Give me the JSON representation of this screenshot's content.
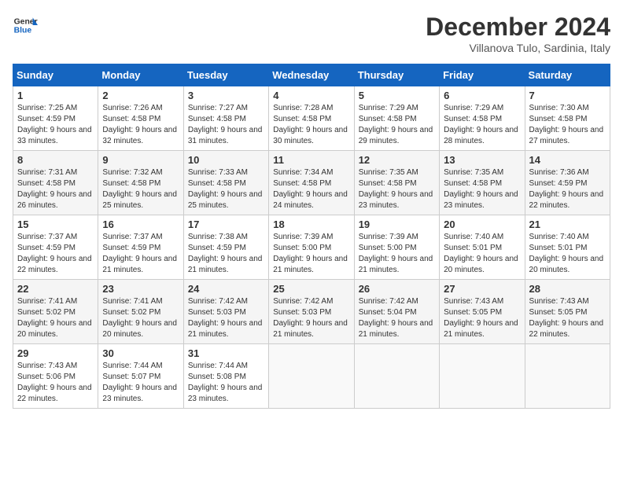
{
  "header": {
    "logo_line1": "General",
    "logo_line2": "Blue",
    "month": "December 2024",
    "location": "Villanova Tulo, Sardinia, Italy"
  },
  "days_of_week": [
    "Sunday",
    "Monday",
    "Tuesday",
    "Wednesday",
    "Thursday",
    "Friday",
    "Saturday"
  ],
  "weeks": [
    [
      {
        "day": "1",
        "sunrise": "7:25 AM",
        "sunset": "4:59 PM",
        "daylight": "9 hours and 33 minutes."
      },
      {
        "day": "2",
        "sunrise": "7:26 AM",
        "sunset": "4:58 PM",
        "daylight": "9 hours and 32 minutes."
      },
      {
        "day": "3",
        "sunrise": "7:27 AM",
        "sunset": "4:58 PM",
        "daylight": "9 hours and 31 minutes."
      },
      {
        "day": "4",
        "sunrise": "7:28 AM",
        "sunset": "4:58 PM",
        "daylight": "9 hours and 30 minutes."
      },
      {
        "day": "5",
        "sunrise": "7:29 AM",
        "sunset": "4:58 PM",
        "daylight": "9 hours and 29 minutes."
      },
      {
        "day": "6",
        "sunrise": "7:29 AM",
        "sunset": "4:58 PM",
        "daylight": "9 hours and 28 minutes."
      },
      {
        "day": "7",
        "sunrise": "7:30 AM",
        "sunset": "4:58 PM",
        "daylight": "9 hours and 27 minutes."
      }
    ],
    [
      {
        "day": "8",
        "sunrise": "7:31 AM",
        "sunset": "4:58 PM",
        "daylight": "9 hours and 26 minutes."
      },
      {
        "day": "9",
        "sunrise": "7:32 AM",
        "sunset": "4:58 PM",
        "daylight": "9 hours and 25 minutes."
      },
      {
        "day": "10",
        "sunrise": "7:33 AM",
        "sunset": "4:58 PM",
        "daylight": "9 hours and 25 minutes."
      },
      {
        "day": "11",
        "sunrise": "7:34 AM",
        "sunset": "4:58 PM",
        "daylight": "9 hours and 24 minutes."
      },
      {
        "day": "12",
        "sunrise": "7:35 AM",
        "sunset": "4:58 PM",
        "daylight": "9 hours and 23 minutes."
      },
      {
        "day": "13",
        "sunrise": "7:35 AM",
        "sunset": "4:58 PM",
        "daylight": "9 hours and 23 minutes."
      },
      {
        "day": "14",
        "sunrise": "7:36 AM",
        "sunset": "4:59 PM",
        "daylight": "9 hours and 22 minutes."
      }
    ],
    [
      {
        "day": "15",
        "sunrise": "7:37 AM",
        "sunset": "4:59 PM",
        "daylight": "9 hours and 22 minutes."
      },
      {
        "day": "16",
        "sunrise": "7:37 AM",
        "sunset": "4:59 PM",
        "daylight": "9 hours and 21 minutes."
      },
      {
        "day": "17",
        "sunrise": "7:38 AM",
        "sunset": "4:59 PM",
        "daylight": "9 hours and 21 minutes."
      },
      {
        "day": "18",
        "sunrise": "7:39 AM",
        "sunset": "5:00 PM",
        "daylight": "9 hours and 21 minutes."
      },
      {
        "day": "19",
        "sunrise": "7:39 AM",
        "sunset": "5:00 PM",
        "daylight": "9 hours and 21 minutes."
      },
      {
        "day": "20",
        "sunrise": "7:40 AM",
        "sunset": "5:01 PM",
        "daylight": "9 hours and 20 minutes."
      },
      {
        "day": "21",
        "sunrise": "7:40 AM",
        "sunset": "5:01 PM",
        "daylight": "9 hours and 20 minutes."
      }
    ],
    [
      {
        "day": "22",
        "sunrise": "7:41 AM",
        "sunset": "5:02 PM",
        "daylight": "9 hours and 20 minutes."
      },
      {
        "day": "23",
        "sunrise": "7:41 AM",
        "sunset": "5:02 PM",
        "daylight": "9 hours and 20 minutes."
      },
      {
        "day": "24",
        "sunrise": "7:42 AM",
        "sunset": "5:03 PM",
        "daylight": "9 hours and 21 minutes."
      },
      {
        "day": "25",
        "sunrise": "7:42 AM",
        "sunset": "5:03 PM",
        "daylight": "9 hours and 21 minutes."
      },
      {
        "day": "26",
        "sunrise": "7:42 AM",
        "sunset": "5:04 PM",
        "daylight": "9 hours and 21 minutes."
      },
      {
        "day": "27",
        "sunrise": "7:43 AM",
        "sunset": "5:05 PM",
        "daylight": "9 hours and 21 minutes."
      },
      {
        "day": "28",
        "sunrise": "7:43 AM",
        "sunset": "5:05 PM",
        "daylight": "9 hours and 22 minutes."
      }
    ],
    [
      {
        "day": "29",
        "sunrise": "7:43 AM",
        "sunset": "5:06 PM",
        "daylight": "9 hours and 22 minutes."
      },
      {
        "day": "30",
        "sunrise": "7:44 AM",
        "sunset": "5:07 PM",
        "daylight": "9 hours and 23 minutes."
      },
      {
        "day": "31",
        "sunrise": "7:44 AM",
        "sunset": "5:08 PM",
        "daylight": "9 hours and 23 minutes."
      },
      null,
      null,
      null,
      null
    ]
  ]
}
